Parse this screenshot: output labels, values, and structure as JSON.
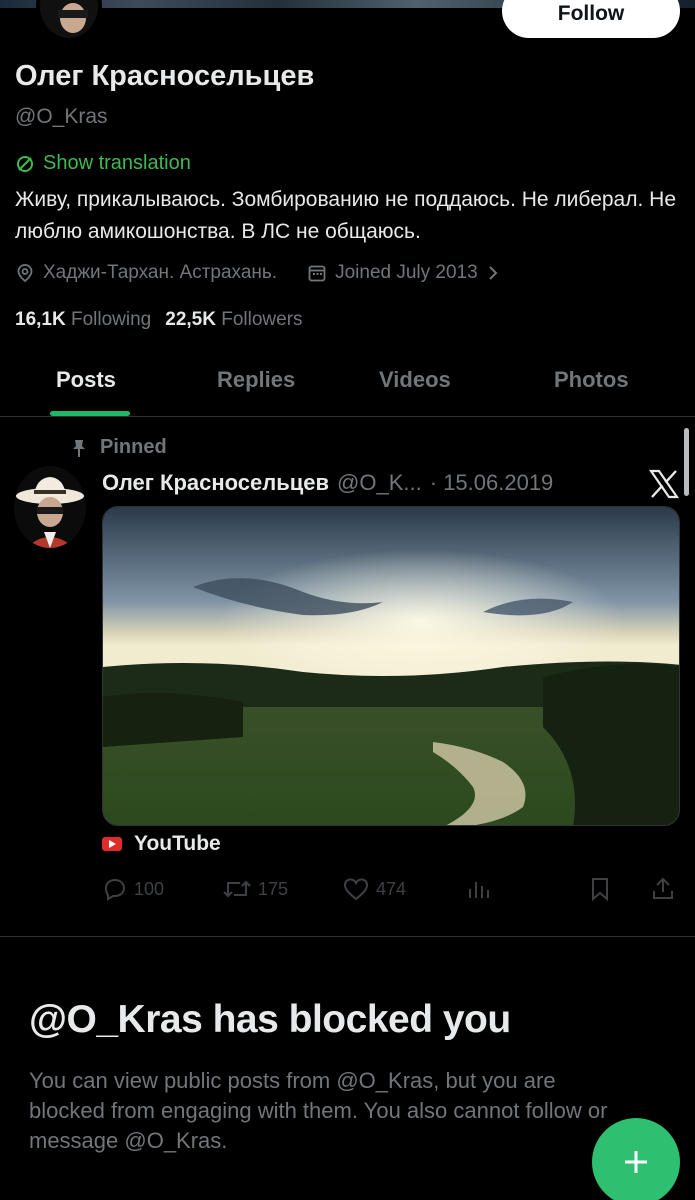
{
  "profile": {
    "name": "Олег Красносельцев",
    "handle": "@O_Kras",
    "follow_label": "Follow",
    "translation_label": "Show translation",
    "bio": "Живу, прикалываюсь. Зомбированию не поддаюсь. Не либерал. Не люблю амикошонства. В ЛС не общаюсь.",
    "location": "Хаджи-Тархан. Астрахань.",
    "joined": "Joined July 2013",
    "following_count": "16,1K",
    "following_label": "Following",
    "followers_count": "22,5K",
    "followers_label": "Followers"
  },
  "tabs": [
    {
      "label": "Posts",
      "active": true
    },
    {
      "label": "Replies",
      "active": false
    },
    {
      "label": "Videos",
      "active": false
    },
    {
      "label": "Photos",
      "active": false
    }
  ],
  "post": {
    "pinned_label": "Pinned",
    "author_name": "Олег Красносельцев",
    "author_handle": "@O_K...",
    "date": "· 15.06.2019",
    "link_source": "YouTube",
    "replies": "100",
    "reposts": "175",
    "likes": "474"
  },
  "blocked": {
    "title": "@O_Kras has blocked you",
    "text": "You can view public posts from @O_Kras, but you are blocked from engaging with them. You also cannot follow or message @O_Kras."
  },
  "icons": {
    "translate": "translate-icon",
    "location": "location-icon",
    "calendar": "calendar-icon",
    "pin": "pin-icon",
    "x_logo": "x-logo-icon",
    "reply": "reply-icon",
    "repost": "repost-icon",
    "like": "like-icon",
    "views": "views-icon",
    "bookmark": "bookmark-icon",
    "share": "share-icon",
    "compose": "plus-icon"
  },
  "colors": {
    "accent": "#1fba68",
    "translate": "#3fb950",
    "fab": "#2fbf71",
    "muted": "#71767b"
  }
}
